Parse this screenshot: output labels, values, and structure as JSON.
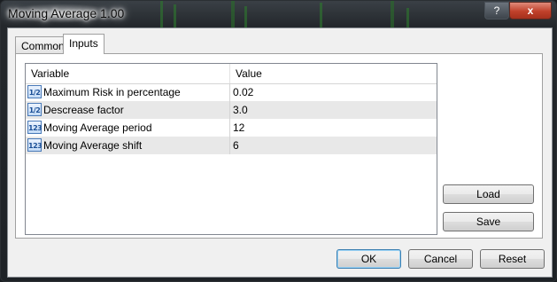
{
  "window": {
    "title": "Moving Average 1.00",
    "help_label": "?",
    "close_label": "x"
  },
  "tabs": [
    {
      "label": "Common",
      "selected": false
    },
    {
      "label": "Inputs",
      "selected": true
    }
  ],
  "grid": {
    "headers": {
      "variable": "Variable",
      "value": "Value"
    },
    "rows": [
      {
        "icon": "fraction-icon",
        "icon_text": "1/2",
        "variable": "Maximum Risk in percentage",
        "value": "0.02"
      },
      {
        "icon": "fraction-icon",
        "icon_text": "1/2",
        "variable": "Descrease factor",
        "value": "3.0"
      },
      {
        "icon": "integer-icon",
        "icon_text": "123",
        "variable": "Moving Average period",
        "value": "12"
      },
      {
        "icon": "integer-icon",
        "icon_text": "123",
        "variable": "Moving Average shift",
        "value": "6"
      }
    ]
  },
  "side_buttons": {
    "load": "Load",
    "save": "Save"
  },
  "footer": {
    "ok": "OK",
    "cancel": "Cancel",
    "reset": "Reset"
  },
  "colors": {
    "close_button": "#c0402a",
    "default_button_border": "#3c7fb1",
    "row_alt": "#e8e8e8"
  }
}
